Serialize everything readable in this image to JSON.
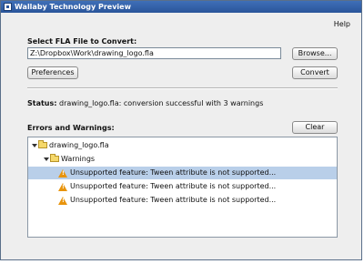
{
  "window": {
    "title": "Wallaby Technology Preview"
  },
  "menu": {
    "help": "Help"
  },
  "file_section": {
    "label": "Select FLA File to Convert:",
    "path_value": "Z:\\Dropbox\\Work\\drawing_logo.fla",
    "browse_label": "Browse...",
    "preferences_label": "Preferences",
    "convert_label": "Convert"
  },
  "status": {
    "label": "Status:",
    "text": "drawing_logo.fla: conversion successful with 3 warnings"
  },
  "errors": {
    "label": "Errors and Warnings:",
    "clear_label": "Clear",
    "tree": {
      "root": "drawing_logo.fla",
      "group": "Warnings",
      "items": [
        "Unsupported feature: Tween attribute is not supported...",
        "Unsupported feature: Tween attribute is not supported...",
        "Unsupported feature: Tween attribute is not supported..."
      ],
      "selected_index": 0
    }
  },
  "icons": {
    "app": "app-icon",
    "folder": "folder-icon",
    "warning": "warning-icon",
    "expand": "expand-arrow-icon"
  },
  "colors": {
    "titlebar": "#2a559a",
    "selection": "#b9cfe9",
    "warning": "#e8940c",
    "folder": "#f5d86a"
  }
}
